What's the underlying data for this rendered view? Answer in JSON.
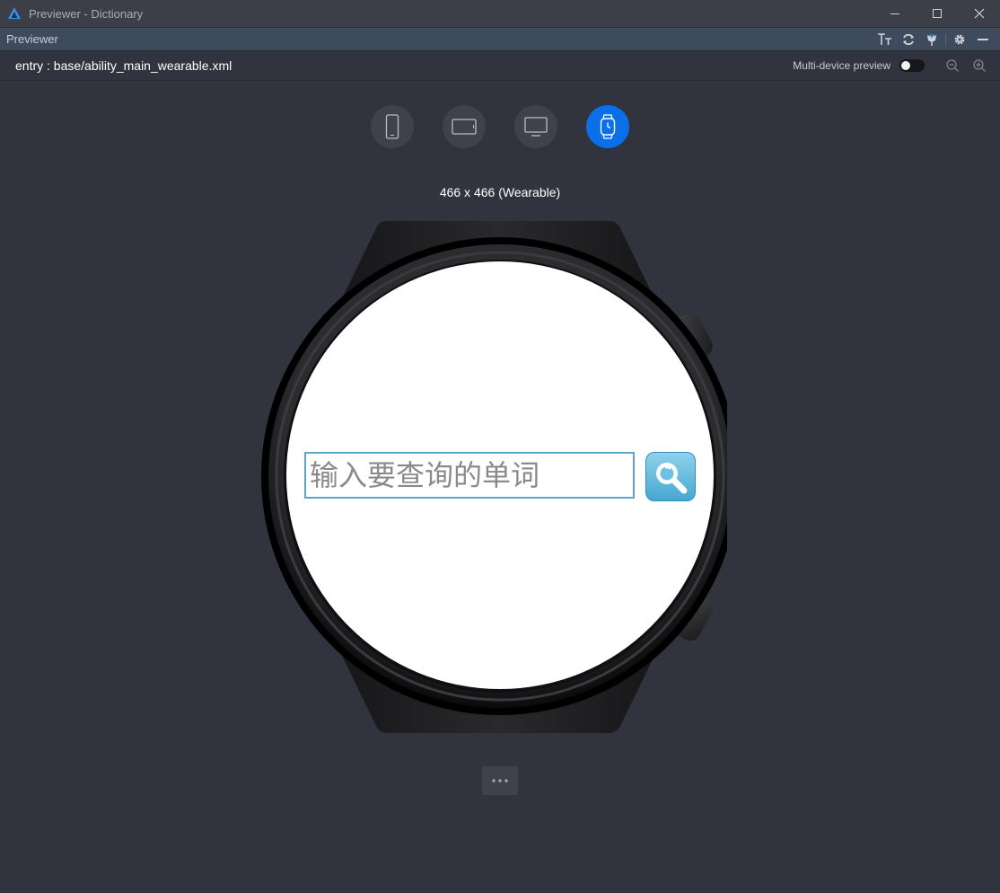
{
  "window": {
    "title": "Previewer - Dictionary",
    "controls": [
      "minimize-icon",
      "maximize-icon",
      "close-icon"
    ]
  },
  "toolbar": {
    "title": "Previewer",
    "actions": [
      "font-size-icon",
      "refresh-icon",
      "pin-icon",
      "gear-icon",
      "hide-icon"
    ]
  },
  "pathbar": {
    "path": "entry : base/ability_main_wearable.xml",
    "multi_device_label": "Multi-device preview",
    "multi_device_enabled": false
  },
  "devices": [
    {
      "name": "phone",
      "icon": "phone-icon",
      "active": false
    },
    {
      "name": "tablet",
      "icon": "tablet-icon",
      "active": false
    },
    {
      "name": "tv",
      "icon": "tv-icon",
      "active": false
    },
    {
      "name": "wearable",
      "icon": "watch-icon",
      "active": true
    }
  ],
  "resolution_label": "466 x 466 (Wearable)",
  "app": {
    "search_placeholder": "输入要查询的单词",
    "search_value": ""
  },
  "colors": {
    "active_device": "#0a6fe8",
    "background": "#31343e",
    "input_border": "#5ba5cf"
  }
}
